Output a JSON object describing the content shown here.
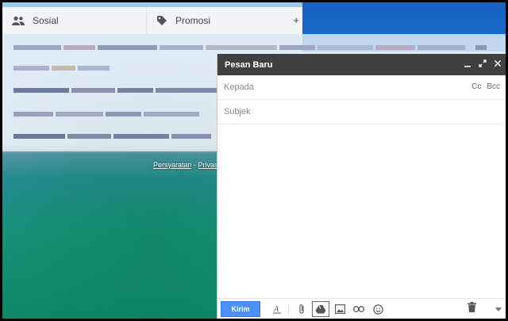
{
  "tabs": [
    {
      "label": "Sosial",
      "icon": "people-icon"
    },
    {
      "label": "Promosi",
      "icon": "tag-icon"
    }
  ],
  "add_tab_symbol": "+",
  "footer": {
    "terms": "Persyaratan",
    "separator": " - ",
    "privacy": "Privasi"
  },
  "compose": {
    "title": "Pesan Baru",
    "to_placeholder": "Kepada",
    "cc": "Cc",
    "bcc": "Bcc",
    "subject_placeholder": "Subjek",
    "send_label": "Kirim"
  },
  "colors": {
    "accent": "#4d90fe",
    "compose_header": "#404040"
  }
}
